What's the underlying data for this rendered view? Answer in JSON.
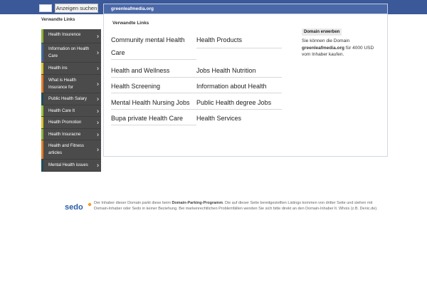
{
  "topbar": {
    "search_button_label": "Anzeigen suchen"
  },
  "sidebar": {
    "title": "Verwandte Links",
    "items": [
      {
        "label": "Health Insurence",
        "color": "#8bb338"
      },
      {
        "label": "Information on Health Care",
        "color": "#3f6a9e"
      },
      {
        "label": "Health ins",
        "color": "#d7c22b"
      },
      {
        "label": "What is Health Insurance for",
        "color": "#e57b24"
      },
      {
        "label": "Public Health Salary",
        "color": "#1e4d5a"
      },
      {
        "label": "Health Care It",
        "color": "#9ac23c"
      },
      {
        "label": "Health Promotion",
        "color": "#d8c42a"
      },
      {
        "label": "Health Insuracne",
        "color": "#8bb338"
      },
      {
        "label": "Health and Fitness articles",
        "color": "#e57b24"
      },
      {
        "label": "Mental Health issues",
        "color": "#1e4d5a"
      }
    ]
  },
  "main": {
    "header": "greenleafmedia.org",
    "panel_title": "Verwandte Links",
    "links_col1": [
      "Community mental Health Care",
      "Health and Wellness",
      "Health Screening",
      "Mental Health Nursing Jobs",
      "Bupa private Health Care"
    ],
    "links_col2": [
      "Health Products",
      "Jobs Health Nutrition",
      "Information about Health",
      "Public Health degree Jobs",
      "Health Services"
    ]
  },
  "domain": {
    "buy_label": "Domain erwerben",
    "text_prefix": "Sie können die Domain",
    "domain_name": "greenleafmedia.org",
    "text_suffix": "für 4000 USD vom Inhaber kaufen."
  },
  "footer": {
    "logo_text": "sedo",
    "text_part1": "Der Inhaber dieser Domain parkt diese beim",
    "program_name": "Domain-Parking-Programm",
    "text_part2": ". Die auf dieser Seite bereitgestellten Listings kommen von dritter Seite und stehen mit Domain-Inhaber oder Sedo in keiner Beziehung. Bei markenrechtlichen Problemfällen wenden Sie sich bitte direkt an den Domain-Inhaber lt. Whois (z.B. Denic.de)."
  }
}
